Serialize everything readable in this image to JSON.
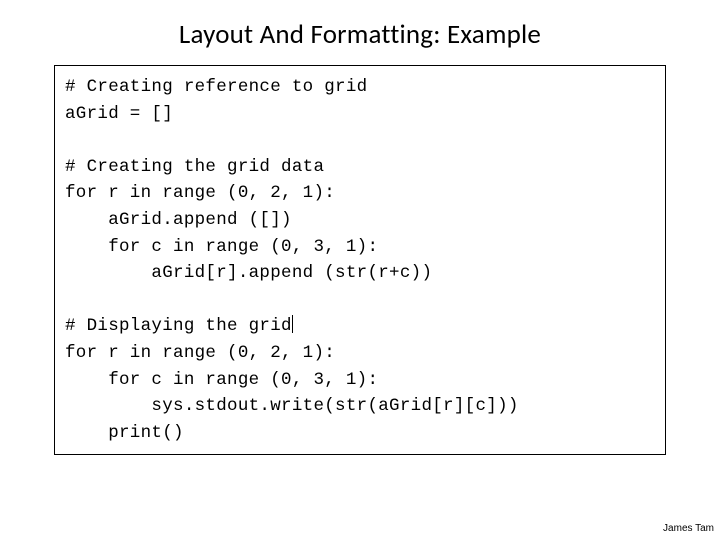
{
  "slide": {
    "title": "Layout And Formatting: Example",
    "footer": "James Tam"
  },
  "code": {
    "lines": [
      "# Creating reference to grid",
      "aGrid = []",
      "",
      "# Creating the grid data",
      "for r in range (0, 2, 1):",
      "    aGrid.append ([])",
      "    for c in range (0, 3, 1):",
      "        aGrid[r].append (str(r+c))",
      "",
      "# Displaying the grid",
      "for r in range (0, 2, 1):",
      "    for c in range (0, 3, 1):",
      "        sys.stdout.write(str(aGrid[r][c]))",
      "    print()"
    ],
    "caret_line": 9,
    "caret_col": 22
  }
}
